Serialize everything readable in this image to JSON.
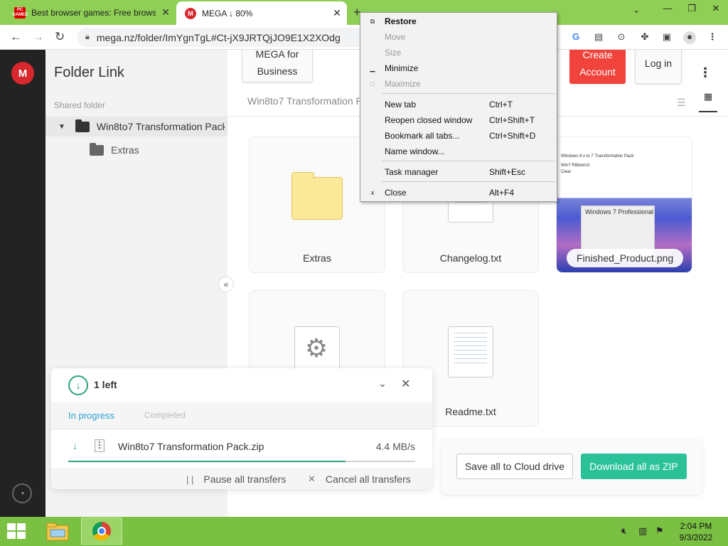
{
  "browser": {
    "tabs": [
      {
        "title": "Best browser games: Free browse",
        "favicon": "pcgames-icon",
        "favicon_text": "PC GAMES",
        "active": false
      },
      {
        "title": "MEGA ↓ 80%",
        "favicon": "mega-icon",
        "favicon_text": "M",
        "active": true
      }
    ],
    "url": "mega.nz/folder/ImYgnTgL#Ct-jX9JRTQjJO9E1X2XOdg",
    "accent": "#8fcf55"
  },
  "context_menu": {
    "items": [
      {
        "label": "Restore",
        "shortcut": "",
        "icon": "restore-icon",
        "icon_glyph": "⧉",
        "enabled": true,
        "bold": true
      },
      {
        "label": "Move",
        "shortcut": "",
        "icon": "",
        "icon_glyph": "",
        "enabled": false,
        "bold": false
      },
      {
        "label": "Size",
        "shortcut": "",
        "icon": "",
        "icon_glyph": "",
        "enabled": false,
        "bold": false
      },
      {
        "label": "Minimize",
        "shortcut": "",
        "icon": "minimize-icon",
        "icon_glyph": "▁",
        "enabled": true,
        "bold": false
      },
      {
        "label": "Maximize",
        "shortcut": "",
        "icon": "maximize-icon",
        "icon_glyph": "□",
        "enabled": false,
        "bold": false
      },
      {
        "label": "New tab",
        "shortcut": "Ctrl+T",
        "icon": "",
        "icon_glyph": "",
        "enabled": true,
        "bold": false
      },
      {
        "label": "Reopen closed window",
        "shortcut": "Ctrl+Shift+T",
        "icon": "",
        "icon_glyph": "",
        "enabled": true,
        "bold": false
      },
      {
        "label": "Bookmark all tabs...",
        "shortcut": "Ctrl+Shift+D",
        "icon": "",
        "icon_glyph": "",
        "enabled": true,
        "bold": false
      },
      {
        "label": "Name window...",
        "shortcut": "",
        "icon": "",
        "icon_glyph": "",
        "enabled": true,
        "bold": false
      },
      {
        "label": "Task manager",
        "shortcut": "Shift+Esc",
        "icon": "",
        "icon_glyph": "",
        "enabled": true,
        "bold": false
      },
      {
        "label": "Close",
        "shortcut": "Alt+F4",
        "icon": "close-icon",
        "icon_glyph": "x",
        "enabled": true,
        "bold": false
      }
    ]
  },
  "mega": {
    "header_buttons": {
      "business": "MEGA for Business",
      "create": "Create Account",
      "login": "Log in"
    },
    "sidebar": {
      "title": "Folder Link",
      "section": "Shared folder",
      "root": "Win8to7 Transformation Pack",
      "child": "Extras"
    },
    "breadcrumb": "Win8to7 Transformation Pack",
    "files": [
      {
        "name": "Extras",
        "kind": "folder"
      },
      {
        "name": "Changelog.txt",
        "kind": "text"
      },
      {
        "name": "Finished_Product.png",
        "kind": "image"
      },
      {
        "name": "",
        "kind": "settings"
      },
      {
        "name": "Readme.txt",
        "kind": "text"
      }
    ],
    "thumbnail_text": {
      "line1": "Windows 8.x to 7 Transformation Pack",
      "line2": "Win7 RibbonUI",
      "line3": "Clear",
      "win7": "Windows 7 Professional"
    },
    "actions": {
      "save": "Save all to Cloud drive",
      "download": "Download all as ZIP"
    },
    "transfers": {
      "count": "1 left",
      "tab_in_progress": "In progress",
      "tab_completed": "Completed",
      "file": "Win8to7 Transformation Pack.zip",
      "speed": "4.4 MB/s",
      "progress": 0.8,
      "pause": "Pause all transfers",
      "cancel": "Cancel all transfers"
    },
    "brand_color": "#d9272e",
    "success_color": "#2bc29a"
  },
  "taskbar": {
    "time": "2:04 PM",
    "date": "9/3/2022",
    "color": "#7ac143"
  }
}
